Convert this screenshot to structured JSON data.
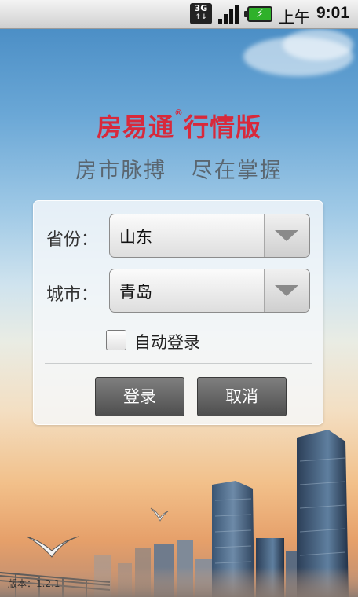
{
  "status_bar": {
    "network": "3G",
    "battery_icon": "battery-charging-icon",
    "ampm": "上午",
    "time": "9:01"
  },
  "app": {
    "brand_name": "房易通",
    "brand_mark": "®",
    "brand_edition": "行情版",
    "slogan": "房市脉搏   尽在掌握",
    "brand_color": "#d8293b"
  },
  "form": {
    "province_label": "省份：",
    "province_value": "山东",
    "city_label": "城市：",
    "city_value": "青岛",
    "auto_login_label": "自动登录",
    "auto_login_checked": false,
    "login_button": "登录",
    "cancel_button": "取消"
  },
  "footer": {
    "version": "版本：1.2.1"
  }
}
